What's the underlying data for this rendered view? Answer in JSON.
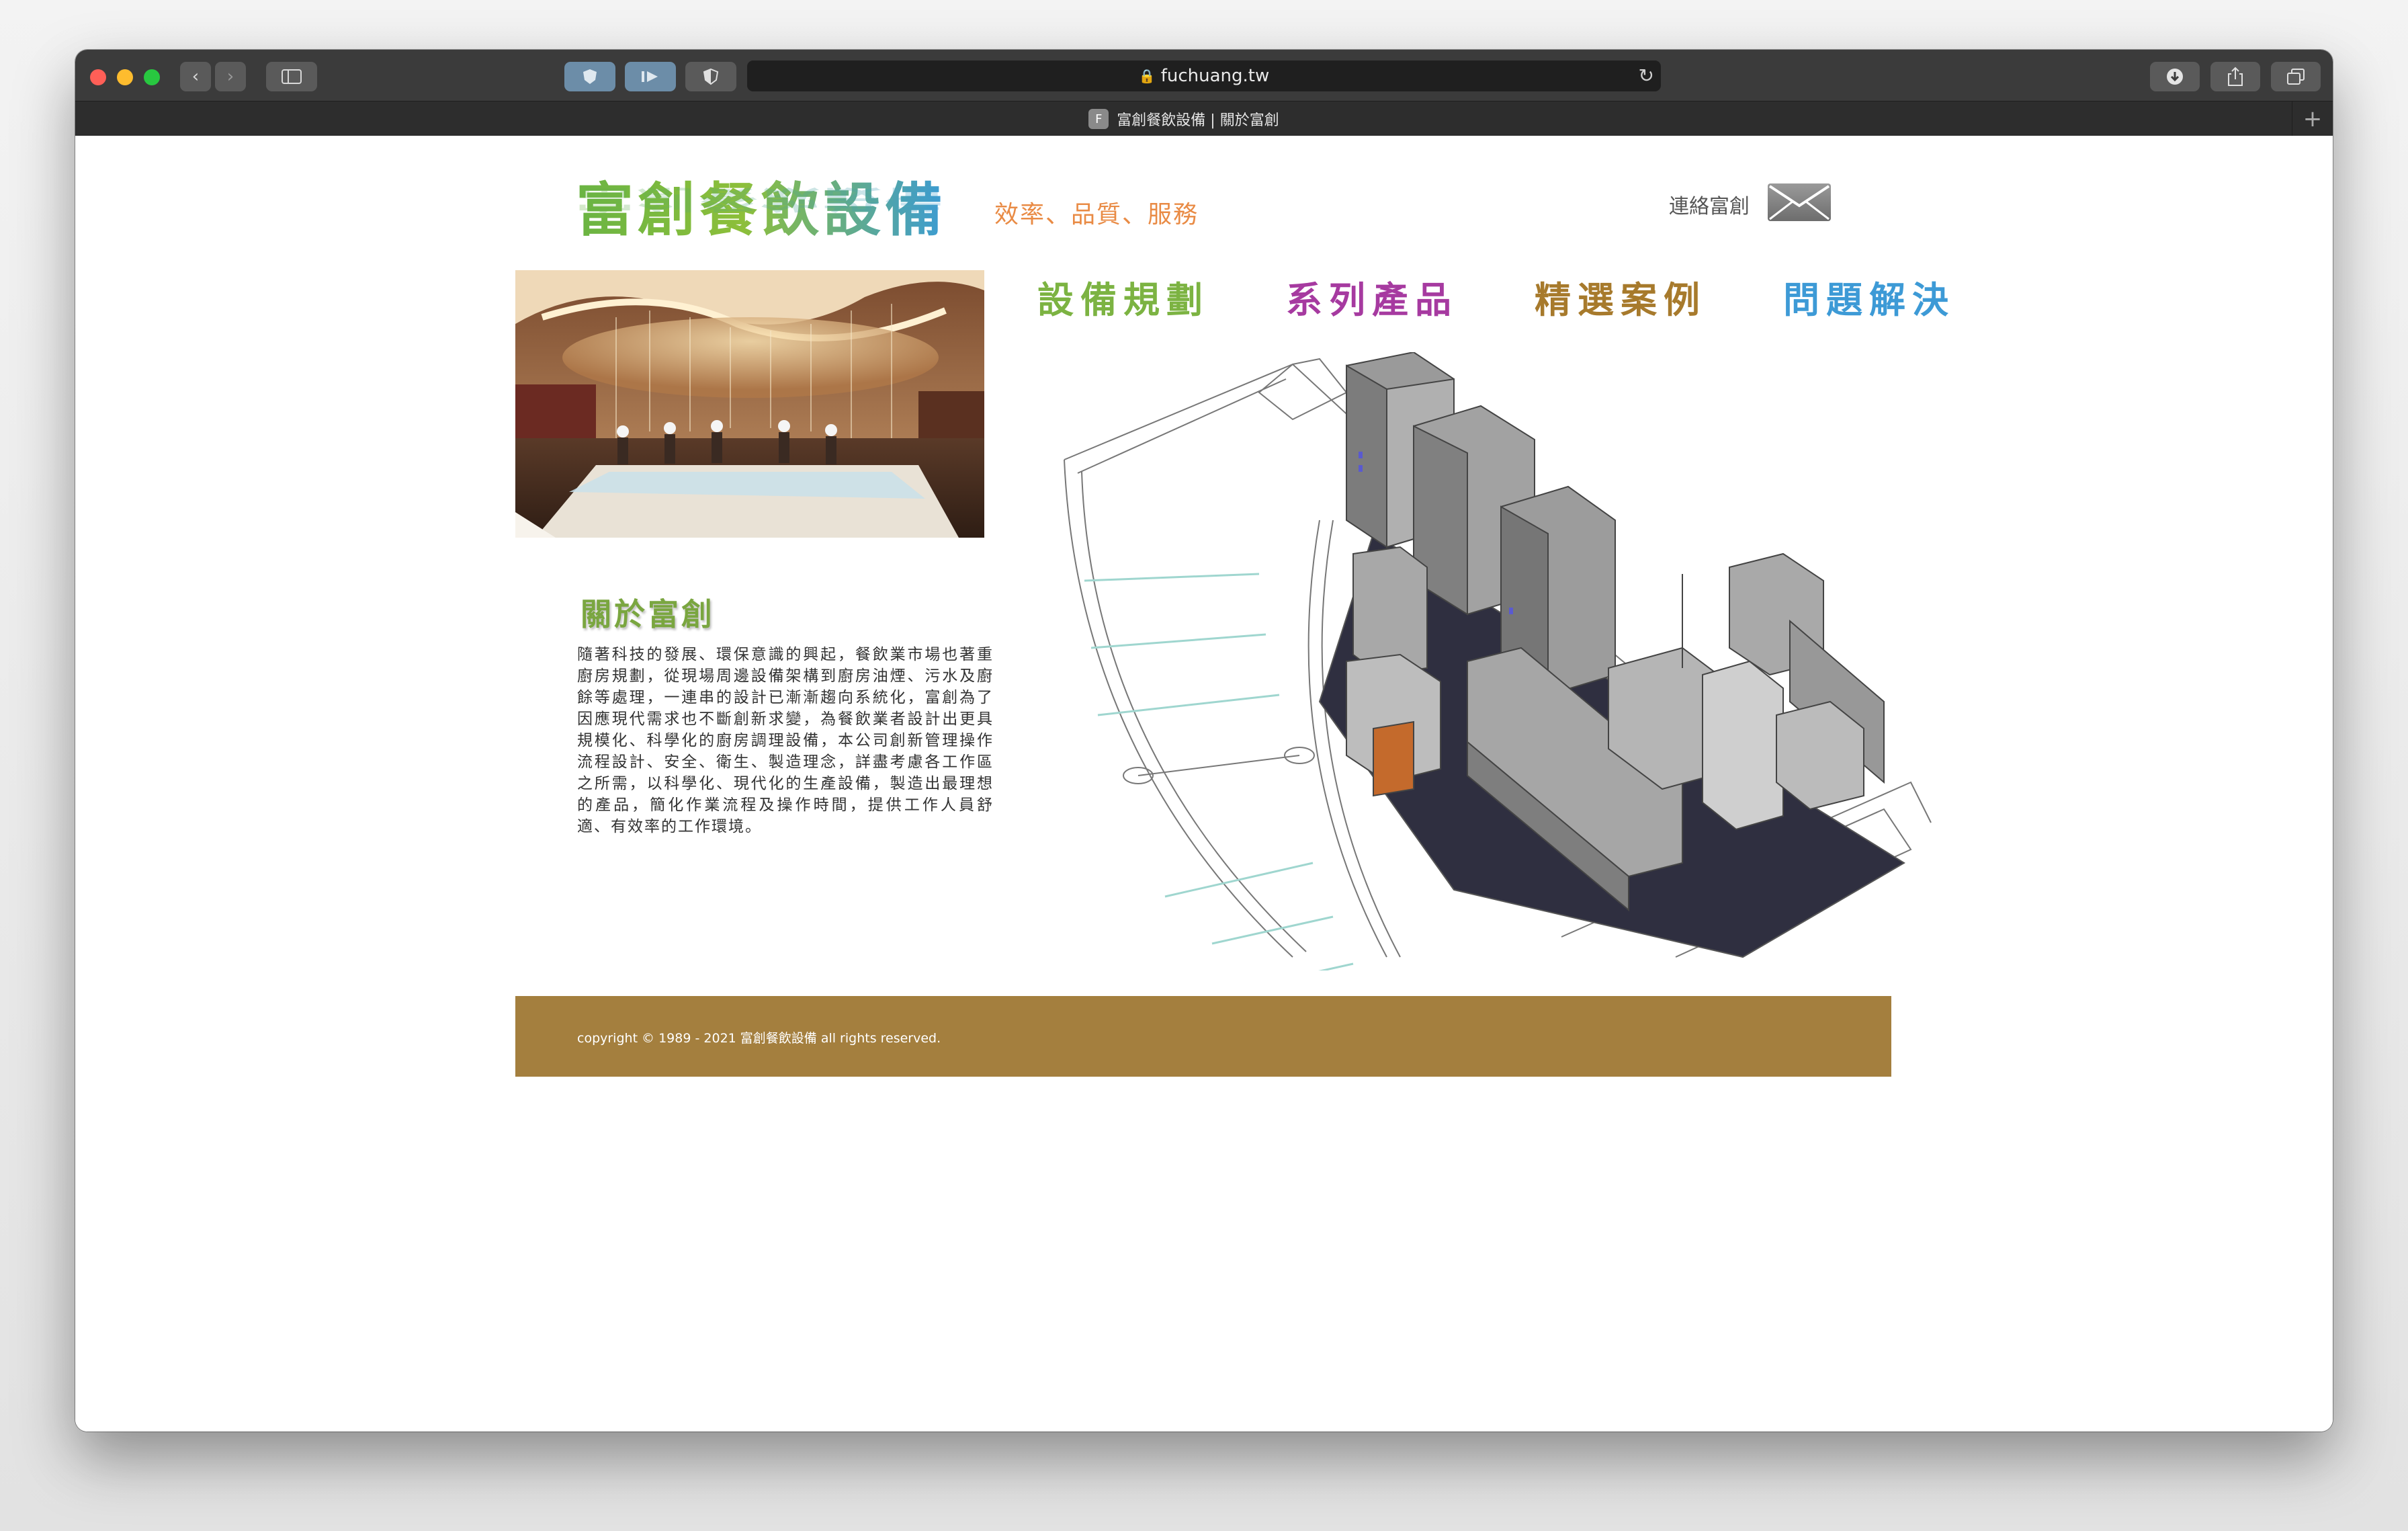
{
  "browser": {
    "url": "fuchuang.tw",
    "tab_title": "富創餐飲設備 | 關於富創",
    "favicon_letter": "F"
  },
  "site": {
    "logo_text": "富創餐飲設備",
    "slogan": "效率、品質、服務",
    "contact_label": "連絡富創",
    "nav": [
      {
        "label": "設備規劃",
        "color": "#7cb342"
      },
      {
        "label": "系列產品",
        "color": "#a63aa0"
      },
      {
        "label": "精選案例",
        "color": "#a77a2c"
      },
      {
        "label": "問題解決",
        "color": "#3d9ad6"
      }
    ],
    "about_title": "關於富創",
    "about_text": "隨著科技的發展、環保意識的興起，餐飲業市場也著重廚房規劃，從現場周邊設備架構到廚房油煙、污水及廚餘等處理，一連串的設計已漸漸趨向系統化，富創為了因應現代需求也不斷創新求變，為餐飲業者設計出更具規模化、科學化的廚房調理設備，本公司創新管理操作流程設計、安全、衛生、製造理念，詳盡考慮各工作區之所需，以科學化、現代化的生產設備，製造出最理想的產品，簡化作業流程及操作時間，提供工作人員舒適、有效率的工作環境。",
    "copyright": "copyright © 1989 - 2021 富創餐飲設備 all rights reserved.",
    "footer_color": "#a47f3e"
  }
}
